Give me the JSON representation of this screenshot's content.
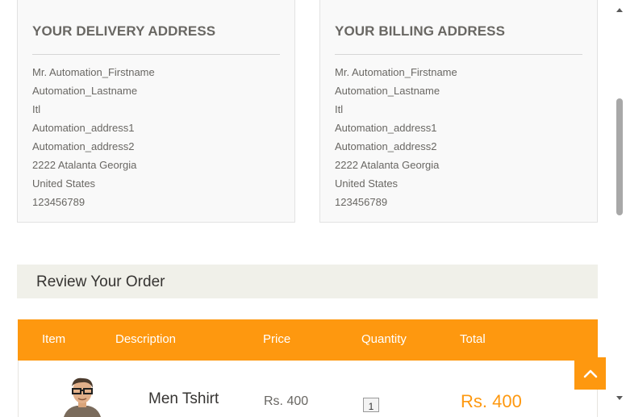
{
  "delivery": {
    "title": "YOUR DELIVERY ADDRESS",
    "lines": [
      "Mr. Automation_Firstname",
      "Automation_Lastname",
      "Itl",
      "Automation_address1",
      "Automation_address2",
      "2222 Atalanta Georgia",
      "United States",
      "123456789"
    ]
  },
  "billing": {
    "title": "YOUR BILLING ADDRESS",
    "lines": [
      "Mr. Automation_Firstname",
      "Automation_Lastname",
      "Itl",
      "Automation_address1",
      "Automation_address2",
      "2222 Atalanta Georgia",
      "United States",
      "123456789"
    ]
  },
  "review": {
    "heading": "Review Your Order"
  },
  "table": {
    "headers": [
      "Item",
      "Description",
      "Price",
      "Quantity",
      "Total"
    ],
    "rows": [
      {
        "item_image": "men-tshirt-thumbnail",
        "description": "Men Tshirt",
        "price": "Rs. 400",
        "quantity": "1",
        "total": "Rs. 400"
      }
    ]
  },
  "icons": {
    "scroll_top": "chevron-up-icon"
  },
  "colors": {
    "accent": "#fe980f",
    "heading_bg": "#f0f0e9",
    "text": "#696763"
  }
}
